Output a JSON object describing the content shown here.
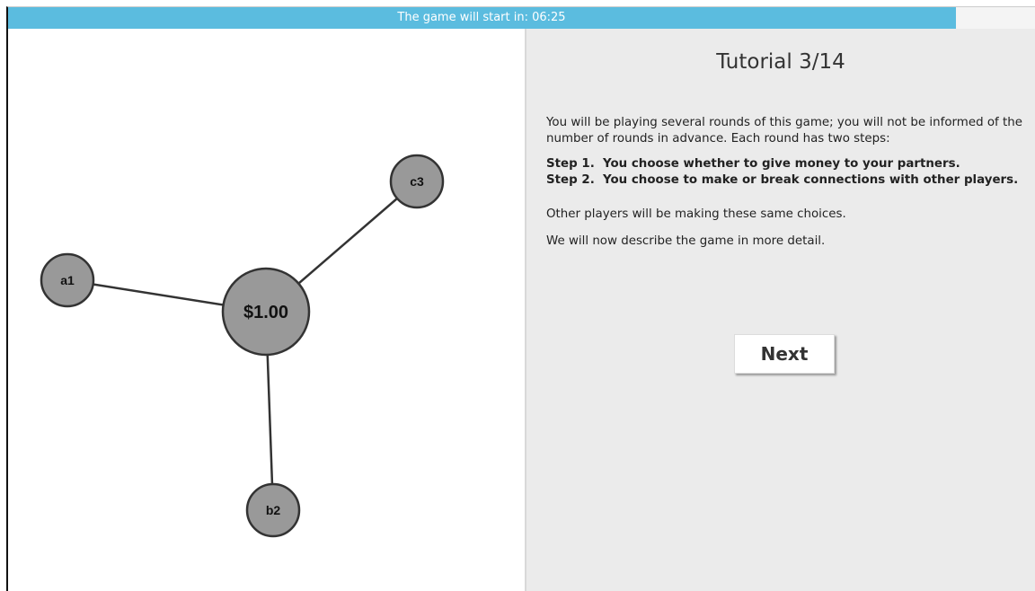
{
  "timer": {
    "text": "The game will start in: 06:25",
    "remaining_fraction": 0.923,
    "color": "#5bbcdf"
  },
  "graph": {
    "center": {
      "label": "$1.00"
    },
    "nodes": [
      {
        "id": "a1",
        "label": "a1"
      },
      {
        "id": "b2",
        "label": "b2"
      },
      {
        "id": "c3",
        "label": "c3"
      }
    ]
  },
  "tutorial": {
    "title": "Tutorial 3/14",
    "intro": "You will be playing several rounds of this game; you will not be informed of the number of rounds in advance. Each round has two steps:",
    "steps": [
      {
        "num": "Step 1.",
        "text": "You choose whether to give money to your partners."
      },
      {
        "num": "Step 2.",
        "text": "You choose to make or break connections with other players."
      }
    ],
    "note": "Other players will be making these same choices.",
    "outro": "We will now describe the game in more detail.",
    "next_label": "Next"
  }
}
